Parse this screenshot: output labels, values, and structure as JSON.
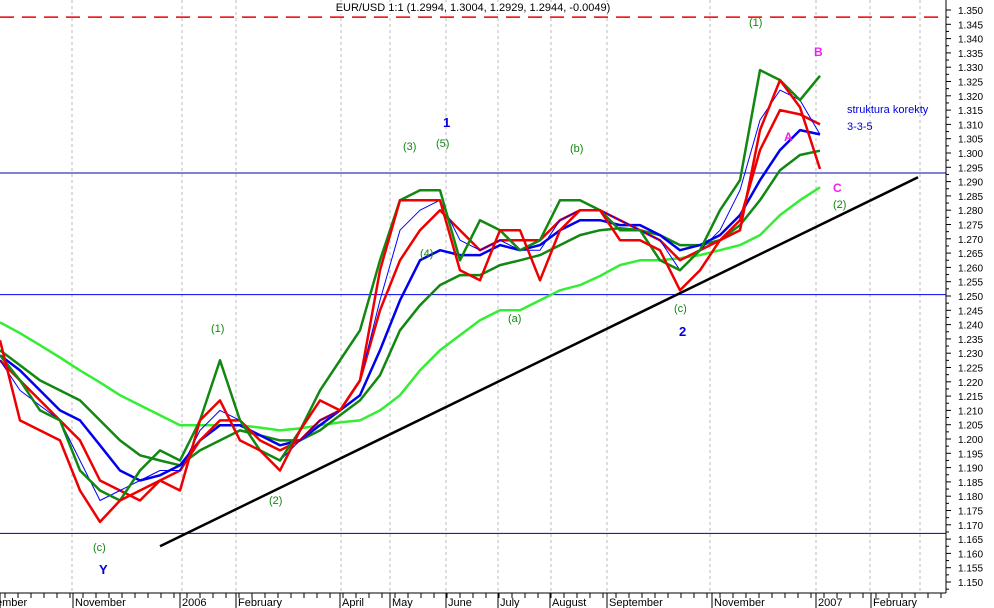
{
  "chart_data": {
    "type": "line",
    "title": "EUR/USD 1:1 (1.2994, 1.3004, 1.2929, 1.2944, -0.0049)",
    "ylim": [
      1.15,
      1.35
    ],
    "y_tick_step": 0.005,
    "x_tick_labels": [
      "ember",
      "November",
      "2006",
      "February",
      "April",
      "May",
      "June",
      "July",
      "August",
      "September",
      "November",
      "2007",
      "February"
    ],
    "grid": "vertical dashed",
    "series": [
      {
        "name": "light-green-ma",
        "color": "#33ee33",
        "values": [
          1.2408,
          1.237,
          1.2328,
          1.2285,
          1.224,
          1.2198,
          1.2153,
          1.2118,
          1.2083,
          1.2048,
          1.2048,
          1.2048,
          1.2048,
          1.204,
          1.203,
          1.2037,
          1.2048,
          1.2058,
          1.2065,
          1.21,
          1.2153,
          1.224,
          1.231,
          1.2363,
          1.2415,
          1.245,
          1.245,
          1.2485,
          1.252,
          1.2538,
          1.257,
          1.2608,
          1.2625,
          1.2625,
          1.2632,
          1.2643,
          1.266,
          1.2678,
          1.2713,
          1.2783,
          1.2835,
          1.288
        ]
      },
      {
        "name": "dark-green-ma",
        "color": "#118811",
        "values": [
          1.231,
          1.2258,
          1.2205,
          1.217,
          1.2135,
          1.2065,
          1.1995,
          1.1943,
          1.1925,
          1.1908,
          1.196,
          1.1995,
          1.203,
          1.2013,
          1.1995,
          1.1995,
          1.203,
          1.2083,
          1.2135,
          1.2223,
          1.238,
          1.2468,
          1.2538,
          1.2573,
          1.2573,
          1.2608,
          1.2625,
          1.2643,
          1.2678,
          1.2713,
          1.273,
          1.2737,
          1.273,
          1.2713,
          1.2678,
          1.2678,
          1.2695,
          1.2748,
          1.2835,
          1.294,
          1.2993,
          1.3008
        ]
      },
      {
        "name": "blue-ma",
        "color": "#0000ee",
        "values": [
          1.2293,
          1.224,
          1.217,
          1.21,
          1.2065,
          1.1978,
          1.189,
          1.1855,
          1.1873,
          1.1908,
          1.1995,
          1.2048,
          1.2048,
          1.2013,
          1.1978,
          1.1995,
          1.2048,
          1.21,
          1.2153,
          1.231,
          1.2485,
          1.2625,
          1.266,
          1.2643,
          1.2643,
          1.2678,
          1.266,
          1.2678,
          1.273,
          1.2765,
          1.2765,
          1.2748,
          1.2748,
          1.2713,
          1.266,
          1.2678,
          1.2713,
          1.2783,
          1.2905,
          1.301,
          1.308,
          1.3065
        ]
      },
      {
        "name": "red-ma",
        "color": "#ee0000",
        "values": [
          1.2275,
          1.2205,
          1.2135,
          1.2065,
          1.1995,
          1.1855,
          1.182,
          1.1785,
          1.1855,
          1.189,
          1.1995,
          1.2065,
          1.2065,
          1.1995,
          1.196,
          1.1995,
          1.2065,
          1.21,
          1.2205,
          1.245,
          1.2625,
          1.273,
          1.28,
          1.273,
          1.266,
          1.2695,
          1.2695,
          1.2695,
          1.2765,
          1.28,
          1.28,
          1.2765,
          1.273,
          1.2695,
          1.2625,
          1.266,
          1.2695,
          1.2765,
          1.301,
          1.315,
          1.3135,
          1.31
        ]
      },
      {
        "name": "thin-blue-ma",
        "color": "#0000ff",
        "values": [
          1.2275,
          1.217,
          1.2117,
          1.2065,
          1.1925,
          1.1785,
          1.182,
          1.1855,
          1.189,
          1.189,
          1.203,
          1.21,
          1.2065,
          1.196,
          1.1925,
          1.1995,
          1.2065,
          1.21,
          1.2205,
          1.2485,
          1.273,
          1.28,
          1.2835,
          1.2695,
          1.266,
          1.2695,
          1.266,
          1.266,
          1.2765,
          1.28,
          1.28,
          1.2765,
          1.273,
          1.2695,
          1.259,
          1.266,
          1.273,
          1.287,
          1.3115,
          1.322,
          1.3185,
          1.3065
        ]
      },
      {
        "name": "green-price",
        "color": "#118811",
        "values": [
          1.2293,
          1.2205,
          1.21,
          1.2065,
          1.189,
          1.182,
          1.1785,
          1.189,
          1.196,
          1.1925,
          1.2065,
          1.2275,
          1.2065,
          1.196,
          1.1925,
          1.203,
          1.217,
          1.2275,
          1.238,
          1.2625,
          1.2835,
          1.287,
          1.287,
          1.2625,
          1.2765,
          1.273,
          1.266,
          1.2695,
          1.2835,
          1.2835,
          1.28,
          1.273,
          1.273,
          1.2625,
          1.259,
          1.266,
          1.28,
          1.2905,
          1.329,
          1.3255,
          1.3185,
          1.327
        ]
      },
      {
        "name": "red-price",
        "color": "#ee0000",
        "values": [
          1.2345,
          1.2065,
          1.203,
          1.1995,
          1.182,
          1.171,
          1.1785,
          1.182,
          1.1855,
          1.182,
          1.2065,
          1.2135,
          1.1995,
          1.196,
          1.189,
          1.203,
          1.2135,
          1.21,
          1.2205,
          1.259,
          1.2835,
          1.2835,
          1.2835,
          1.259,
          1.2555,
          1.273,
          1.273,
          1.2555,
          1.273,
          1.28,
          1.28,
          1.2695,
          1.2695,
          1.266,
          1.252,
          1.259,
          1.2695,
          1.273,
          1.308,
          1.3255,
          1.316,
          1.2944
        ]
      }
    ],
    "horizontal_lines": [
      {
        "name": "resistance-dashed",
        "value": 1.3475,
        "color": "#ee0000"
      },
      {
        "name": "level-upper",
        "value": 1.293,
        "color": "#0000aa"
      },
      {
        "name": "level-middle",
        "value": 1.2505,
        "color": "#0000ee"
      },
      {
        "name": "level-lower",
        "value": 1.167,
        "color": "#0000aa"
      }
    ],
    "trendline": {
      "from": 1.1625,
      "to": 1.2915,
      "color": "#000000"
    },
    "annotations": {
      "c1": "(c)",
      "Y": "Y",
      "w1": "(1)",
      "w2": "(2)",
      "w3": "(3)",
      "w5": "(5)",
      "one": "1",
      "w4": "(4)",
      "b": "(b)",
      "a": "(a)",
      "c2": "(c)",
      "two": "2",
      "w1b": "(1)",
      "A": "A",
      "B": "B",
      "C": "C",
      "w2b": "(2)",
      "note1": "struktura korekty",
      "note2": "3-3-5"
    }
  }
}
